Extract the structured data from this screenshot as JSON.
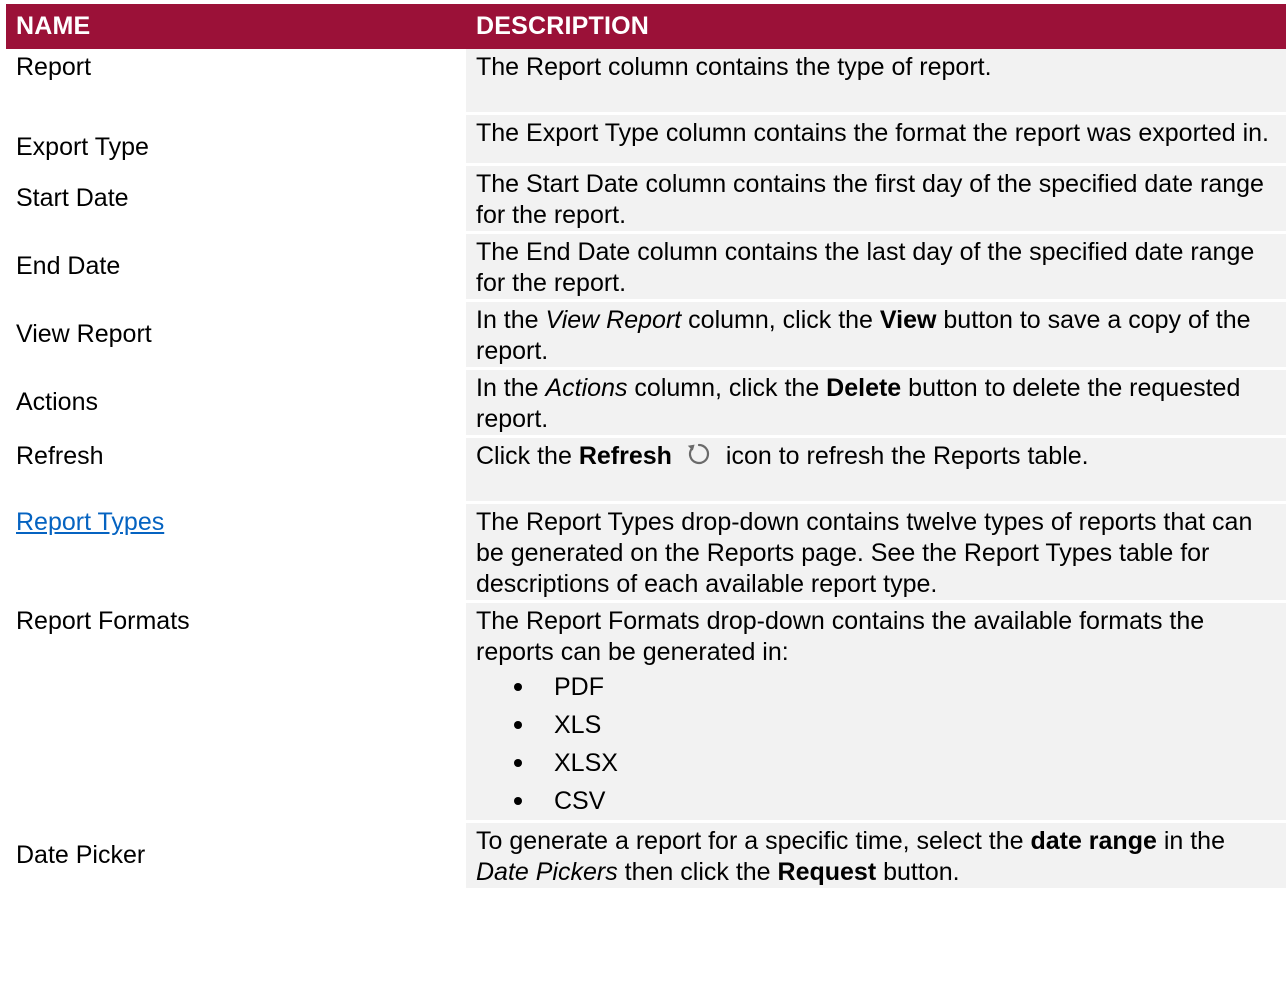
{
  "header": {
    "name_label": "NAME",
    "description_label": "DESCRIPTION",
    "color": "#9b1138"
  },
  "rows": {
    "report": {
      "name": "Report",
      "description": "The Report column contains the type of report."
    },
    "export_type": {
      "name": "Export Type",
      "description": "The Export Type column contains the format the report was exported in."
    },
    "start_date": {
      "name": "Start Date",
      "description": "The Start Date column contains the first day of the specified date range for the report."
    },
    "end_date": {
      "name": "End Date",
      "description": "The End Date column contains the last day of the specified date range for the report."
    },
    "view_report": {
      "name": "View Report",
      "desc_part1": "In the ",
      "desc_italic": "View Report",
      "desc_part2": " column, click the ",
      "desc_bold": "View",
      "desc_part3": " button to save a copy of the report."
    },
    "actions": {
      "name": "Actions",
      "desc_part1": "In the ",
      "desc_italic": "Actions",
      "desc_part2": " column, click the ",
      "desc_bold": "Delete",
      "desc_part3": " button to delete the requested report."
    },
    "refresh": {
      "name": "Refresh",
      "desc_part1": "Click the ",
      "desc_bold": "Refresh",
      "desc_part2": "icon to refresh the Reports table.",
      "icon": "refresh-icon"
    },
    "report_types": {
      "name": "Report Types",
      "description": "The Report Types drop-down contains twelve types of reports that can be generated on the Reports page. See the Report Types table for descriptions of each available report type."
    },
    "report_formats": {
      "name": "Report Formats",
      "description": "The Report Formats drop-down contains the available formats the reports can be generated in:",
      "formats": [
        "PDF",
        "XLS",
        "XLSX",
        "CSV"
      ]
    },
    "date_picker": {
      "name": "Date Picker",
      "desc_part1": "To generate a report for a specific time, select the ",
      "desc_bold1": "date range",
      "desc_part2": " in the ",
      "desc_italic": "Date Pickers",
      "desc_part3": " then click the ",
      "desc_bold2": "Request",
      "desc_part4": " button."
    }
  }
}
